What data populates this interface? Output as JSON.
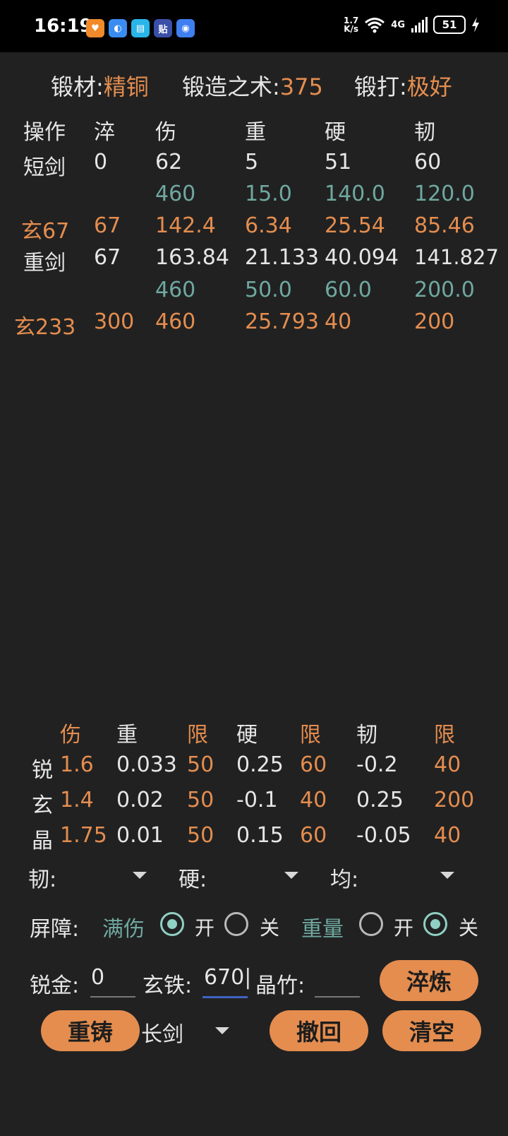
{
  "status": {
    "time": "16:19",
    "speed_top": "1.7",
    "speed_bottom": "K/s",
    "network": "4G",
    "battery": "51"
  },
  "header": {
    "material_label": "锻材:",
    "material_value": "精铜",
    "skill_label": "锻造之术:",
    "skill_value": "375",
    "forge_label": "锻打:",
    "forge_value": "极好"
  },
  "table": {
    "headers": [
      "操作",
      "淬",
      "伤",
      "重",
      "硬",
      "韧"
    ],
    "rows": [
      [
        "短剑",
        "0",
        "62",
        "5",
        "51",
        "60"
      ],
      [
        "",
        "",
        "460",
        "15.0",
        "140.0",
        "120.0"
      ],
      [
        "玄67",
        "67",
        "142.4",
        "6.34",
        "25.54",
        "85.46"
      ],
      [
        "重剑",
        "67",
        "163.84",
        "21.133",
        "40.094",
        "141.827"
      ],
      [
        "",
        "",
        "460",
        "50.0",
        "60.0",
        "200.0"
      ],
      [
        "玄233",
        "300",
        "460",
        "25.793",
        "40",
        "200"
      ]
    ]
  },
  "coef": {
    "headers": [
      "伤",
      "重",
      "限",
      "硬",
      "限",
      "韧",
      "限"
    ],
    "rows": [
      [
        "锐",
        "1.6",
        "0.033",
        "50",
        "0.25",
        "60",
        "-0.2",
        "40"
      ],
      [
        "玄",
        "1.4",
        "0.02",
        "50",
        "-0.1",
        "40",
        "0.25",
        "200"
      ],
      [
        "晶",
        "1.75",
        "0.01",
        "50",
        "0.15",
        "60",
        "-0.05",
        "40"
      ]
    ]
  },
  "dropdowns": {
    "tough": "韧:",
    "hard": "硬:",
    "even": "均:"
  },
  "barrier": {
    "label": "屏障:",
    "full_dmg": "满伤",
    "weight": "重量",
    "on": "开",
    "off": "关"
  },
  "inputs": {
    "rui_label": "锐金:",
    "rui_value": "0",
    "xuan_label": "玄铁:",
    "xuan_value": "670",
    "jing_label": "晶竹:",
    "jing_value": ""
  },
  "buttons": {
    "temper": "淬炼",
    "recast": "重铸",
    "undo": "撤回",
    "clear": "清空"
  },
  "weapon_select": "长剑"
}
